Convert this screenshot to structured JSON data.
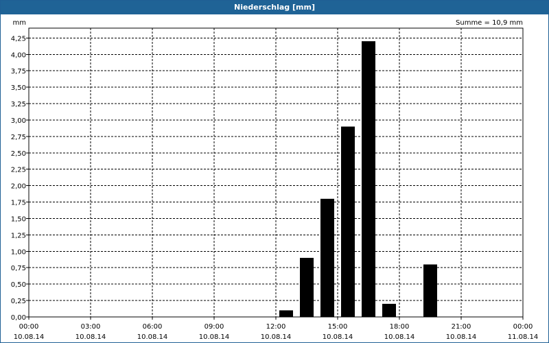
{
  "window": {
    "title": "Niederschlag [mm]"
  },
  "chart_data": {
    "type": "bar",
    "title": "Niederschlag [mm]",
    "ylabel": "mm",
    "summary": "Summe = 10,9 mm",
    "ylim": [
      0,
      4.4
    ],
    "yticks": [
      "0,00",
      "0,25",
      "0,50",
      "0,75",
      "1,00",
      "1,25",
      "1,50",
      "1,75",
      "2,00",
      "2,25",
      "2,50",
      "2,75",
      "3,00",
      "3,25",
      "3,50",
      "3,75",
      "4,00",
      "4,25"
    ],
    "xlim_hours": [
      0,
      24
    ],
    "xticks": [
      {
        "time": "00:00",
        "date": "10.08.14"
      },
      {
        "time": "03:00",
        "date": "10.08.14"
      },
      {
        "time": "06:00",
        "date": "10.08.14"
      },
      {
        "time": "09:00",
        "date": "10.08.14"
      },
      {
        "time": "12:00",
        "date": "10.08.14"
      },
      {
        "time": "15:00",
        "date": "10.08.14"
      },
      {
        "time": "18:00",
        "date": "10.08.14"
      },
      {
        "time": "21:00",
        "date": "10.08.14"
      },
      {
        "time": "00:00",
        "date": "11.08.14"
      }
    ],
    "grid": true,
    "bar_color": "#000000",
    "bars": [
      {
        "x": "10.08.14 12:00",
        "value": 0.1
      },
      {
        "x": "10.08.14 13:00",
        "value": 0.9
      },
      {
        "x": "10.08.14 14:00",
        "value": 1.8
      },
      {
        "x": "10.08.14 15:00",
        "value": 2.9
      },
      {
        "x": "10.08.14 16:00",
        "value": 4.2
      },
      {
        "x": "10.08.14 17:00",
        "value": 0.2
      },
      {
        "x": "10.08.14 19:00",
        "value": 0.8
      }
    ]
  }
}
